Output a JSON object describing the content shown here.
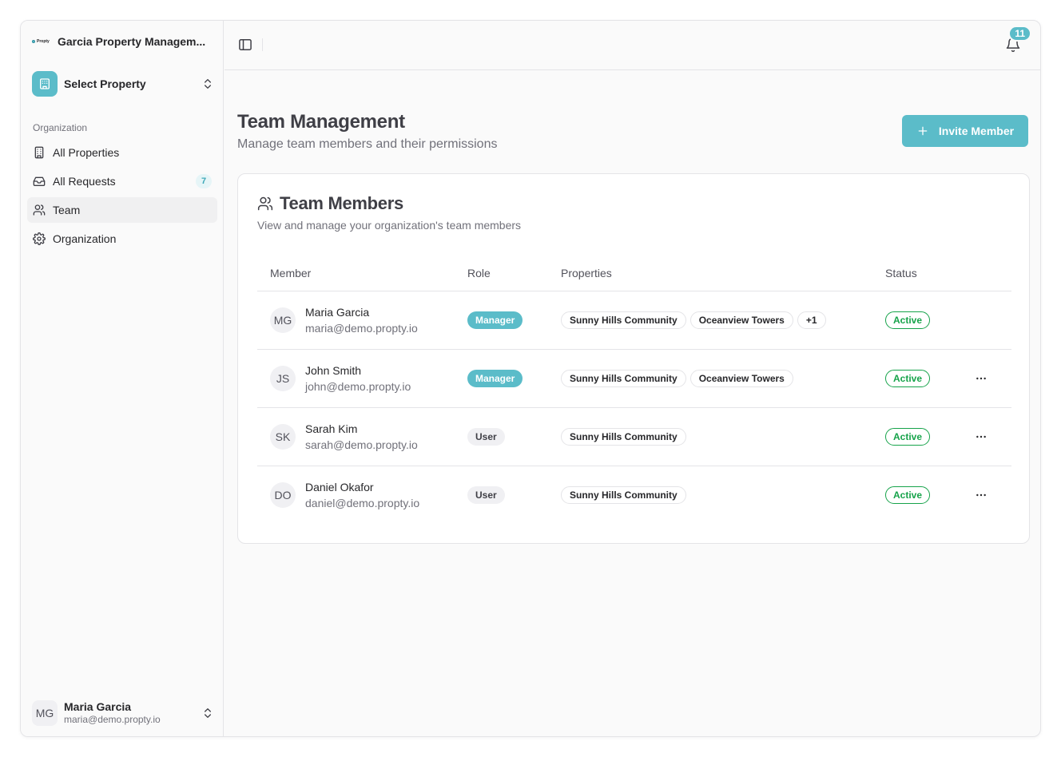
{
  "sidebar": {
    "org_name": "Garcia Property Managem...",
    "logo_text": "Propty",
    "property_select_label": "Select Property",
    "group_label": "Organization",
    "items": [
      {
        "label": "All Properties",
        "icon": "building-icon"
      },
      {
        "label": "All Requests",
        "icon": "inbox-icon",
        "badge": "7"
      },
      {
        "label": "Team",
        "icon": "users-icon",
        "active": true
      },
      {
        "label": "Organization",
        "icon": "gear-icon"
      }
    ],
    "user": {
      "initials": "MG",
      "name": "Maria Garcia",
      "email": "maria@demo.propty.io"
    }
  },
  "topbar": {
    "notification_count": "11"
  },
  "page": {
    "title": "Team Management",
    "subtitle": "Manage team members and their permissions",
    "invite_label": "Invite Member"
  },
  "card": {
    "title": "Team Members",
    "description": "View and manage your organization's team members",
    "columns": [
      "Member",
      "Role",
      "Properties",
      "Status",
      ""
    ],
    "rows": [
      {
        "initials": "MG",
        "name": "Maria Garcia",
        "email": "maria@demo.propty.io",
        "role": "Manager",
        "properties": [
          "Sunny Hills Community",
          "Oceanview Towers",
          "+1"
        ],
        "status": "Active",
        "menu": false
      },
      {
        "initials": "JS",
        "name": "John Smith",
        "email": "john@demo.propty.io",
        "role": "Manager",
        "properties": [
          "Sunny Hills Community",
          "Oceanview Towers"
        ],
        "status": "Active",
        "menu": true
      },
      {
        "initials": "SK",
        "name": "Sarah Kim",
        "email": "sarah@demo.propty.io",
        "role": "User",
        "properties": [
          "Sunny Hills Community"
        ],
        "status": "Active",
        "menu": true
      },
      {
        "initials": "DO",
        "name": "Daniel Okafor",
        "email": "daniel@demo.propty.io",
        "role": "User",
        "properties": [
          "Sunny Hills Community"
        ],
        "status": "Active",
        "menu": true
      }
    ]
  },
  "colors": {
    "accent": "#5bbcc9",
    "active_status": "#16a34a"
  }
}
